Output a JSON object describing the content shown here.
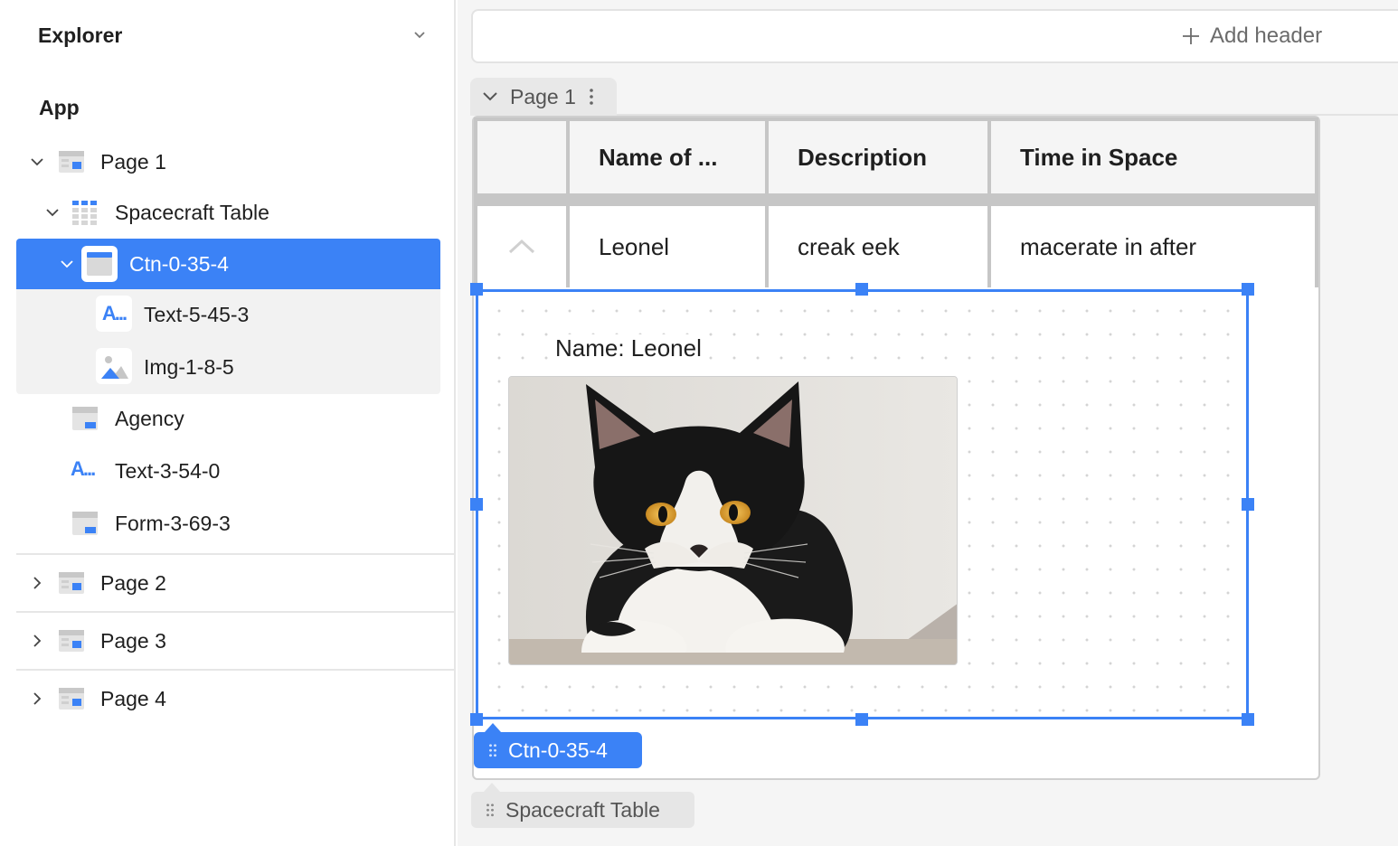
{
  "explorer": {
    "title": "Explorer",
    "app_label": "App",
    "tree": {
      "page1": "Page 1",
      "spacecraft_table": "Spacecraft Table",
      "ctn": "Ctn-0-35-4",
      "text_child": "Text-5-45-3",
      "img_child": "Img-1-8-5",
      "agency": "Agency",
      "text_3": "Text-3-54-0",
      "form": "Form-3-69-3",
      "page2": "Page 2",
      "page3": "Page 3",
      "page4": "Page 4"
    },
    "text_icon_glyph": "A..."
  },
  "canvas": {
    "add_header": "Add header",
    "page_tab": "Page 1",
    "table": {
      "columns": [
        "",
        "Name of ...",
        "Description",
        "Time in Space"
      ],
      "row": [
        "",
        "Leonel",
        "creak eek",
        "macerate in after"
      ]
    },
    "detail": {
      "name_text": "Name: Leonel",
      "image_subject": "black-and-white-kitten"
    },
    "selected_tag": "Ctn-0-35-4",
    "parent_tag": "Spacecraft Table"
  },
  "colors": {
    "accent": "#3b82f6",
    "selection_bg": "#3b82f6",
    "group_bg": "#f2f2f2",
    "canvas_bg": "#f5f5f5"
  }
}
